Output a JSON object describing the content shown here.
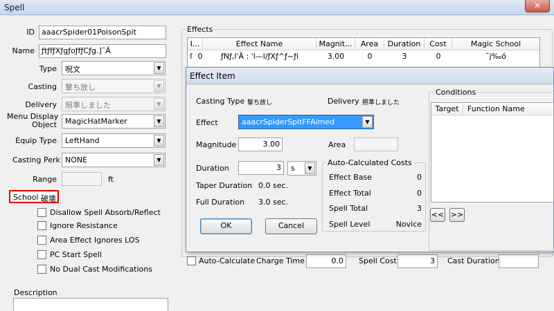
{
  "window": {
    "title": "Spell",
    "close": "✕"
  },
  "form": {
    "id_label": "ID",
    "id_value": "aaacrSpider01PoisonSpit",
    "name_label": "Name",
    "name_value": "ƒtƒfƒXƒgƒoƒfƒCƒg.]˜Ā",
    "type_label": "Type",
    "type_value": "呪文",
    "casting_label": "Casting",
    "casting_value": "撃ち放し",
    "delivery_label": "Delivery",
    "delivery_value": "照準しました",
    "menu_display_label_1": "Menu Display",
    "menu_display_label_2": "Object",
    "menu_display_value": "MagicHatMarker",
    "equip_type_label": "Equip Type",
    "equip_type_value": "LeftHand",
    "casting_perk_label": "Casting Perk",
    "casting_perk_value": "NONE",
    "range_label": "Range",
    "range_value": "",
    "range_unit": "ft",
    "school_label": "School",
    "school_value": "破壊",
    "checkboxes": [
      "Disallow Spell Absorb/Reflect",
      "Ignore Resistance",
      "Area Effect Ignores LOS",
      "PC Start Spell",
      "No Dual Cast Modifications"
    ],
    "description_label": "Description"
  },
  "effects": {
    "group_label": "Effects",
    "columns": [
      "I...",
      "Effect Name",
      "Magnit...",
      "Area",
      "Duration",
      "Cost",
      "Magic School"
    ],
    "rows": [
      {
        "marker": "ſ",
        "index": "0",
        "name": "ƒNƒ‚l'Ā : 'l—l/ƒXƒ^ƒ~ƒi",
        "magnitude": "3.00",
        "area": "0",
        "duration": "3",
        "cost": "0",
        "school": "˜j‰ó"
      }
    ]
  },
  "bottom_bar": {
    "auto_calculate_label": "Auto-Calculate",
    "charge_time_label": "Charge Time",
    "charge_time_value": "0.0",
    "spell_cost_label": "Spell Cost",
    "spell_cost_value": "3",
    "cast_duration_label": "Cast Duration",
    "cast_duration_value": ""
  },
  "dialog": {
    "title": "Effect Item",
    "casting_type_label": "Casting Type",
    "casting_type_value": "撃ち放し",
    "delivery_label": "Delivery",
    "delivery_value": "照準しました",
    "effect_label": "Effect",
    "effect_value": "aaacrSpiderSpitFFAimed",
    "magnitude_label": "Magnitude",
    "magnitude_value": "3.00",
    "area_label": "Area",
    "area_value": "",
    "duration_label": "Duration",
    "duration_value": "3",
    "duration_unit": "s",
    "taper_duration_label": "Taper Duration",
    "taper_duration_value": "0.0 sec.",
    "full_duration_label": "Full Duration",
    "full_duration_value": "3.0 sec.",
    "auto_calc_group_label": "Auto-Calculated Costs",
    "effect_base_label": "Effect Base",
    "effect_base_value": "0",
    "effect_total_label": "Effect Total",
    "effect_total_value": "0",
    "spell_total_label": "Spell Total",
    "spell_total_value": "3",
    "spell_level_label": "Spell Level",
    "spell_level_value": "Novice",
    "ok_label": "OK",
    "cancel_label": "Cancel",
    "conditions_label": "Conditions",
    "conditions_columns": [
      "Target",
      "Function Name"
    ],
    "prev_label": "<<",
    "next_label": ">>"
  }
}
